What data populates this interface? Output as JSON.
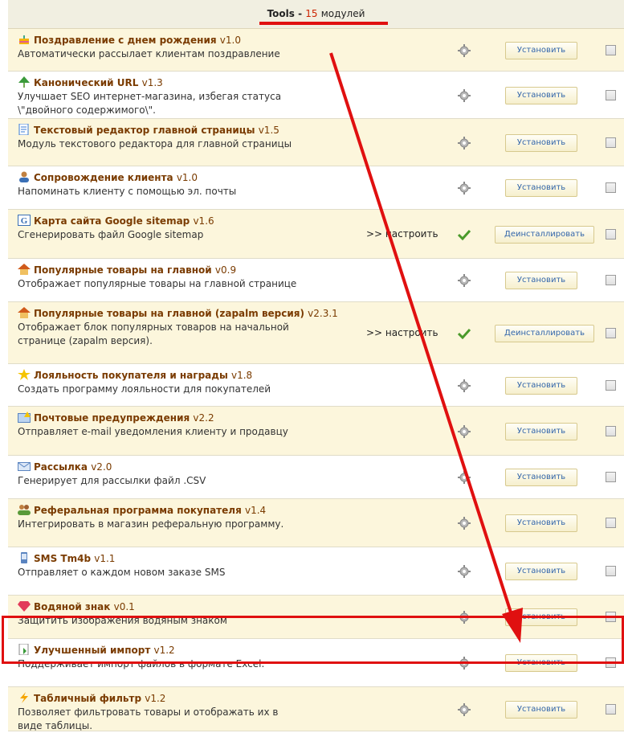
{
  "header": {
    "title_prefix": "Tools",
    "separator": " - ",
    "count": "15",
    "count_word": "модулей"
  },
  "modules": [
    {
      "icon": "birthday-cake-icon",
      "title": "Поздравление с днем рождения",
      "version": "v1.0",
      "description": [
        "Автоматически рассылает клиентам поздравление"
      ],
      "configure": "",
      "status": "not-installed",
      "button": "Установить"
    },
    {
      "icon": "tree-icon",
      "title": "Канонический URL",
      "version": "v1.3",
      "description": [
        "Улучшает SEO интернет-магазина, избегая статуса",
        "\\\"двойного содержимого\\\"."
      ],
      "configure": "",
      "status": "not-installed",
      "button": "Установить"
    },
    {
      "icon": "document-icon",
      "title": "Текстовый редактор главной страницы",
      "version": "v1.5",
      "description": [
        "Модуль текстового редактора для главной страницы"
      ],
      "configure": "",
      "status": "not-installed",
      "button": "Установить"
    },
    {
      "icon": "user-icon",
      "title": "Сопровождение клиента",
      "version": "v1.0",
      "description": [
        "Напоминать клиенту с помощью эл. почты"
      ],
      "configure": "",
      "status": "not-installed",
      "button": "Установить"
    },
    {
      "icon": "google-icon",
      "title": "Карта сайта Google sitemap",
      "version": "v1.6",
      "description": [
        "Сгенерировать файл Google sitemap"
      ],
      "configure": ">> настроить",
      "status": "installed",
      "button": "Деинсталлировать"
    },
    {
      "icon": "home-icon",
      "title": "Популярные товары на главной",
      "version": "v0.9",
      "description": [
        "Отображает популярные товары на главной странице"
      ],
      "configure": "",
      "status": "not-installed",
      "button": "Установить"
    },
    {
      "icon": "home-icon",
      "title": "Популярные товары на главной (zapalm версия)",
      "version": "v2.3.1",
      "description": [
        "Отображает блок популярных товаров на начальной",
        "странице (zapalm версия)."
      ],
      "configure": ">> настроить",
      "status": "installed",
      "button": "Деинсталлировать"
    },
    {
      "icon": "star-icon",
      "title": "Лояльность покупателя и награды",
      "version": "v1.8",
      "description": [
        "Создать программу лояльности для покупателей"
      ],
      "configure": "",
      "status": "not-installed",
      "button": "Установить"
    },
    {
      "icon": "mail-alert-icon",
      "title": "Почтовые предупреждения",
      "version": "v2.2",
      "description": [
        "Отправляет e-mail уведомления клиенту и продавцу"
      ],
      "configure": "",
      "status": "not-installed",
      "button": "Установить"
    },
    {
      "icon": "envelope-icon",
      "title": "Рассылка",
      "version": "v2.0",
      "description": [
        "Генерирует для рассылки файл .CSV"
      ],
      "configure": "",
      "status": "not-installed",
      "button": "Установить"
    },
    {
      "icon": "users-icon",
      "title": "Реферальная программа покупателя",
      "version": "v1.4",
      "description": [
        "Интегрировать в магазин реферальную программу."
      ],
      "configure": "",
      "status": "not-installed",
      "button": "Установить"
    },
    {
      "icon": "phone-icon",
      "title": "SMS Tm4b",
      "version": "v1.1",
      "description": [
        "Отправляет о каждом новом заказе SMS"
      ],
      "configure": "",
      "status": "not-installed",
      "button": "Установить"
    },
    {
      "icon": "gem-icon",
      "title": "Водяной знак",
      "version": "v0.1",
      "description": [
        "Защитить изображения водяным знаком"
      ],
      "configure": "",
      "status": "not-installed",
      "button": "Установить"
    },
    {
      "icon": "import-icon",
      "title": "Улучшенный импорт",
      "version": "v1.2",
      "description": [
        "Поддерживает импорт файлов в формате Excel."
      ],
      "configure": "",
      "status": "not-installed",
      "button": "Установить"
    },
    {
      "icon": "lightning-icon",
      "title": "Табличный фильтр",
      "version": "v1.2",
      "description": [
        "Позволяет фильтровать товары и отображать их в",
        "виде таблицы."
      ],
      "configure": "",
      "status": "not-installed",
      "button": "Установить"
    }
  ],
  "colors": {
    "highlight": "#e01010",
    "title": "#7a3b00",
    "row_alt": "#fcf6dc",
    "button_text": "#3366aa"
  }
}
